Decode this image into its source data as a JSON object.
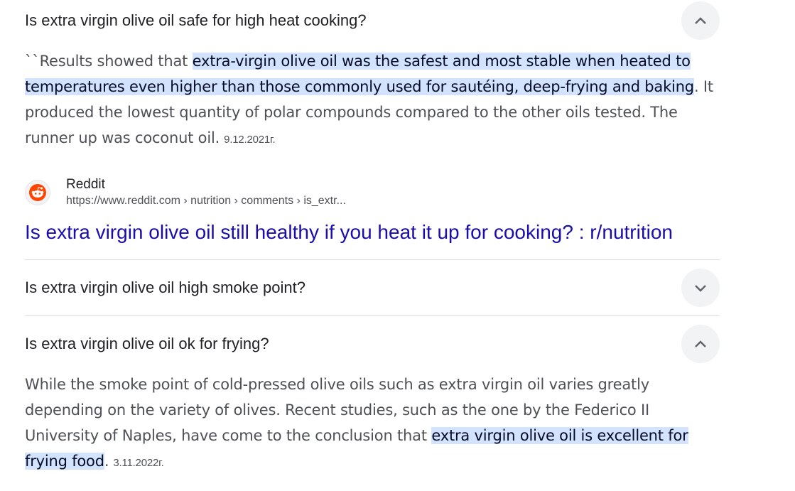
{
  "faq": [
    {
      "question": "Is extra virgin olive oil safe for high heat cooking?",
      "expanded": true,
      "answer_prefix": "``Results showed that ",
      "answer_highlight": "extra-virgin olive oil was the safest and most stable when heated to temperatures even higher than those commonly used for sautéing, deep-frying and baking",
      "answer_suffix": ". It produced the lowest quantity of polar compounds compared to the other oils tested. The runner up was coconut oil.",
      "date": "9.12.2021г.",
      "source": {
        "icon": "reddit-icon",
        "name": "Reddit",
        "url": "https://www.reddit.com › nutrition › comments › is_extr...",
        "title": "Is extra virgin olive oil still healthy if you heat it up for cooking? : r/nutrition"
      }
    },
    {
      "question": "Is extra virgin olive oil high smoke point?",
      "expanded": false
    },
    {
      "question": "Is extra virgin olive oil ok for frying?",
      "expanded": true,
      "answer_prefix": "While the smoke point of cold-pressed olive oils such as extra virgin oil varies greatly depending on the variety of olives. Recent studies, such as the one by the Federico II University of Naples, have come to the conclusion that ",
      "answer_highlight": "extra virgin olive oil is excellent for frying food",
      "answer_suffix": ".",
      "date": "3.11.2022г."
    }
  ],
  "colors": {
    "highlight": "#d3e3fd",
    "link": "#1a0dab",
    "toggle_bg": "#f1f3f4",
    "reddit": "#ff4500"
  }
}
